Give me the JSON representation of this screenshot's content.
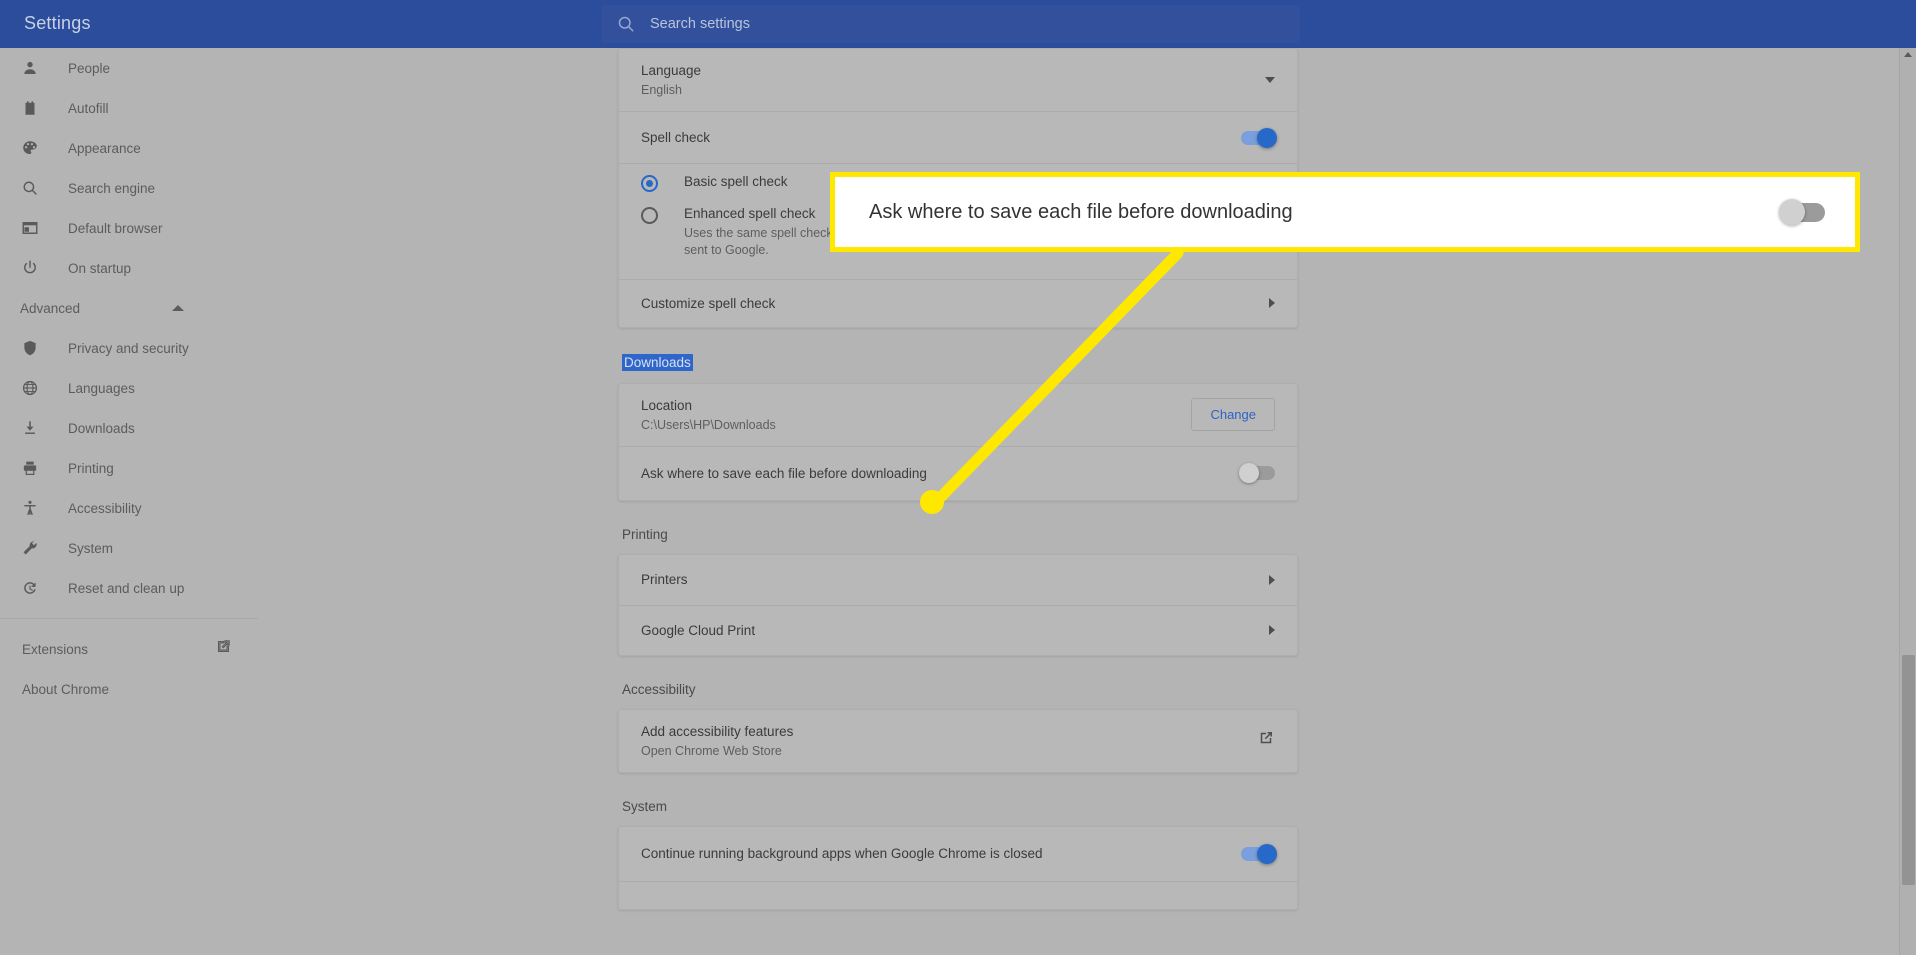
{
  "header": {
    "title": "Settings",
    "search_placeholder": "Search settings",
    "search_value": "",
    "search_icon": "search-icon",
    "bg_color": "#2b4d9b"
  },
  "sidebar": {
    "items": [
      {
        "label": "People",
        "icon": "person-icon"
      },
      {
        "label": "Autofill",
        "icon": "clipboard-icon"
      },
      {
        "label": "Appearance",
        "icon": "palette-icon"
      },
      {
        "label": "Search engine",
        "icon": "search-icon"
      },
      {
        "label": "Default browser",
        "icon": "browser-window-icon"
      },
      {
        "label": "On startup",
        "icon": "power-icon"
      }
    ],
    "advanced": {
      "label": "Advanced",
      "icon": "caret-up-icon",
      "expanded": true
    },
    "advanced_items": [
      {
        "label": "Privacy and security",
        "icon": "shield-icon"
      },
      {
        "label": "Languages",
        "icon": "globe-icon"
      },
      {
        "label": "Downloads",
        "icon": "download-icon"
      },
      {
        "label": "Printing",
        "icon": "printer-icon"
      },
      {
        "label": "Accessibility",
        "icon": "accessibility-icon"
      },
      {
        "label": "System",
        "icon": "wrench-icon"
      },
      {
        "label": "Reset and clean up",
        "icon": "history-restore-icon"
      }
    ],
    "footer_items": [
      {
        "label": "Extensions",
        "icon": "external-link-icon"
      },
      {
        "label": "About Chrome",
        "icon": ""
      }
    ]
  },
  "main": {
    "language_card": {
      "language_label": "Language",
      "language_value": "English",
      "language_expand_icon": "chevron-down-icon",
      "spell_check_label": "Spell check",
      "spell_check_on": true,
      "basic_spell_check": "Basic spell check",
      "basic_selected": true,
      "enhanced_spell_check": "Enhanced spell check",
      "enhanced_selected": false,
      "enhanced_desc": "Uses the same spell checker that's used in Google search. Text you type in the browser is sent to Google.",
      "customize_spell_check": "Customize spell check",
      "customize_icon": "chevron-right-icon"
    },
    "downloads": {
      "section_title": "Downloads",
      "section_title_selected": true,
      "location_label": "Location",
      "location_value": "C:\\Users\\HP\\Downloads",
      "change_button": "Change",
      "ask_where_label": "Ask where to save each file before downloading",
      "ask_where_on": false
    },
    "printing": {
      "section_title": "Printing",
      "rows": [
        {
          "label": "Printers",
          "icon": "chevron-right-icon"
        },
        {
          "label": "Google Cloud Print",
          "icon": "chevron-right-icon"
        }
      ]
    },
    "accessibility": {
      "section_title": "Accessibility",
      "row_title": "Add accessibility features",
      "row_sub": "Open Chrome Web Store",
      "icon": "external-link-icon"
    },
    "system": {
      "section_title": "System",
      "row_title": "Continue running background apps when Google Chrome is closed",
      "row_on": true
    }
  },
  "annotation": {
    "callout_text": "Ask where to save each file before downloading",
    "callout_toggle_on": false,
    "highlight_color": "#ffe800",
    "callout_bg": "#ffffff"
  }
}
